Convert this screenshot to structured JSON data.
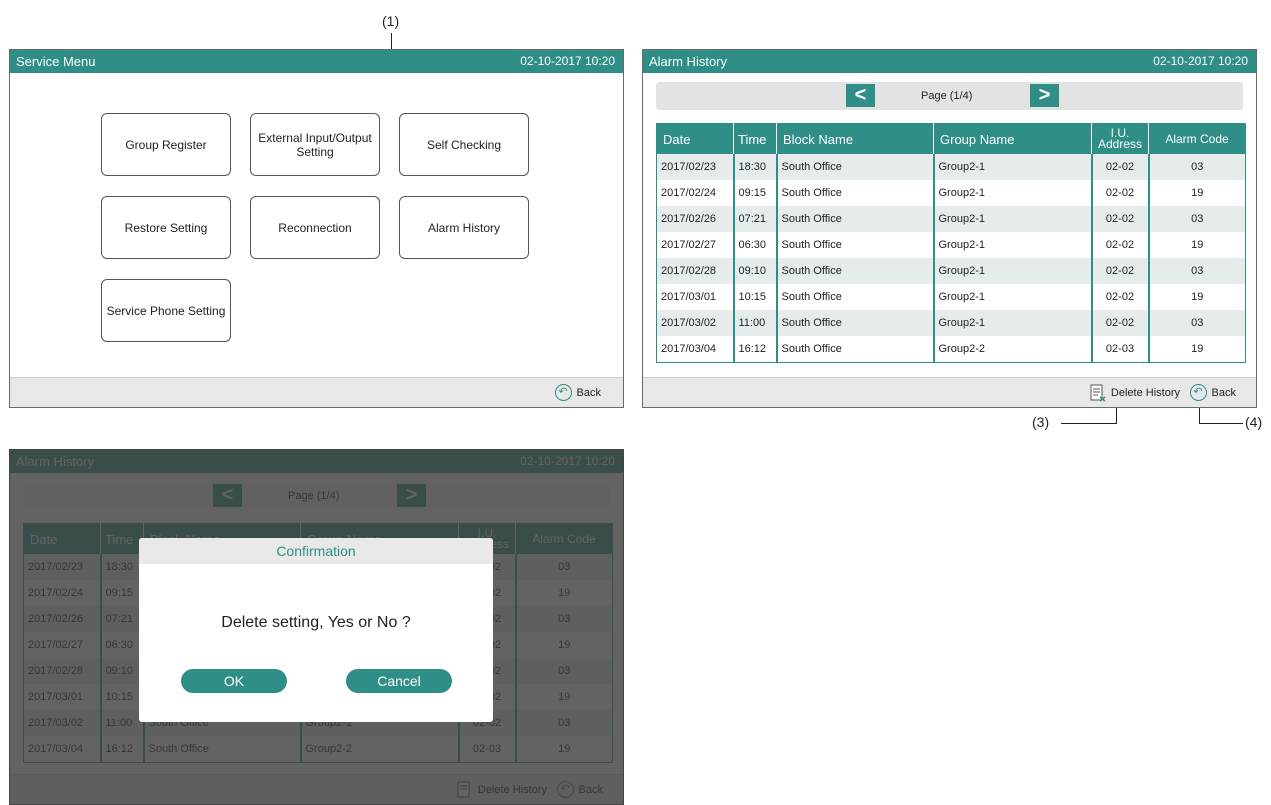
{
  "callouts": {
    "c1": "(1)",
    "c3": "(3)",
    "c4": "(4)"
  },
  "service_menu": {
    "title": "Service Menu",
    "datetime": "02-10-2017   10:20",
    "buttons": [
      "Group Register",
      "External Input/Output Setting",
      "Self Checking",
      "Restore Setting",
      "Reconnection",
      "Alarm History",
      "Service Phone Setting"
    ],
    "back_label": "Back"
  },
  "alarm_history": {
    "title": "Alarm History",
    "datetime": "02-10-2017   10:20",
    "page_label": "Page (1/4)",
    "prev_icon": "<",
    "next_icon": ">",
    "columns": [
      "Date",
      "Time",
      "Block Name",
      "Group Name",
      "I.U. Address",
      "Alarm Code"
    ],
    "rows": [
      [
        "2017/02/23",
        "18:30",
        "South Office",
        "Group2-1",
        "02-02",
        "03"
      ],
      [
        "2017/02/24",
        "09:15",
        "South Office",
        "Group2-1",
        "02-02",
        "19"
      ],
      [
        "2017/02/26",
        "07:21",
        "South Office",
        "Group2-1",
        "02-02",
        "03"
      ],
      [
        "2017/02/27",
        "06:30",
        "South Office",
        "Group2-1",
        "02-02",
        "19"
      ],
      [
        "2017/02/28",
        "09:10",
        "South Office",
        "Group2-1",
        "02-02",
        "03"
      ],
      [
        "2017/03/01",
        "10:15",
        "South Office",
        "Group2-1",
        "02-02",
        "19"
      ],
      [
        "2017/03/02",
        "11:00",
        "South Office",
        "Group2-1",
        "02-02",
        "03"
      ],
      [
        "2017/03/04",
        "16:12",
        "South Office",
        "Group2-2",
        "02-03",
        "19"
      ]
    ],
    "delete_label": "Delete History",
    "back_label": "Back"
  },
  "confirmation": {
    "title": "Confirmation",
    "message": "Delete setting,  Yes or No ?",
    "ok_label": "OK",
    "cancel_label": "Cancel"
  },
  "colors": {
    "accent": "#2f8f86",
    "row_shade": "#e6ecec",
    "footer": "#e8e8e8"
  }
}
